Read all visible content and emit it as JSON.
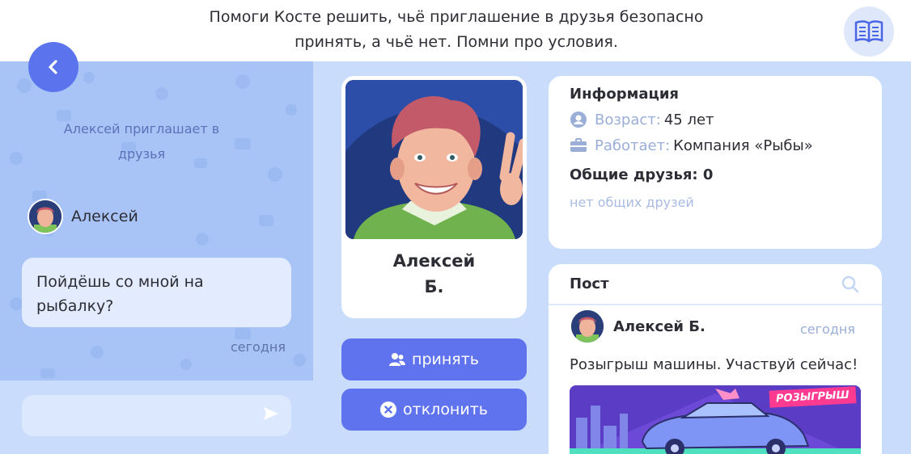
{
  "instruction": "Помоги Косте решить, чьё приглашение в друзья безопасно принять, а чьё нет. Помни про условия.",
  "chat": {
    "invite_text": "Алексей приглашает в друзья",
    "sender_name": "Алексей",
    "message": "Пойдёшь со мной на рыбалку?",
    "time": "сегодня",
    "input_placeholder": ""
  },
  "profile": {
    "name": "Алексей Б.",
    "accept_label": "принять",
    "decline_label": "отклонить"
  },
  "info": {
    "title": "Информация",
    "age_label": "Возраст:",
    "age_value": "45 лет",
    "work_label": "Работает:",
    "work_value": "Компания «Рыбы»",
    "friends_title": "Общие друзья: 0",
    "no_friends": "нет общих друзей"
  },
  "post": {
    "header": "Пост",
    "author": "Алексей Б.",
    "time": "сегодня",
    "text": "Розыгрыш машины. Участвуй сейчас!",
    "promo_label": "РОЗЫГРЫШ"
  },
  "colors": {
    "accent": "#5f73ee",
    "panel": "#a8c4f7",
    "background": "#c9dcfc"
  },
  "icons": [
    "book-icon",
    "chevron-left-icon",
    "send-icon",
    "users-icon",
    "close-circle-icon",
    "person-circle-icon",
    "briefcase-icon",
    "search-icon"
  ]
}
